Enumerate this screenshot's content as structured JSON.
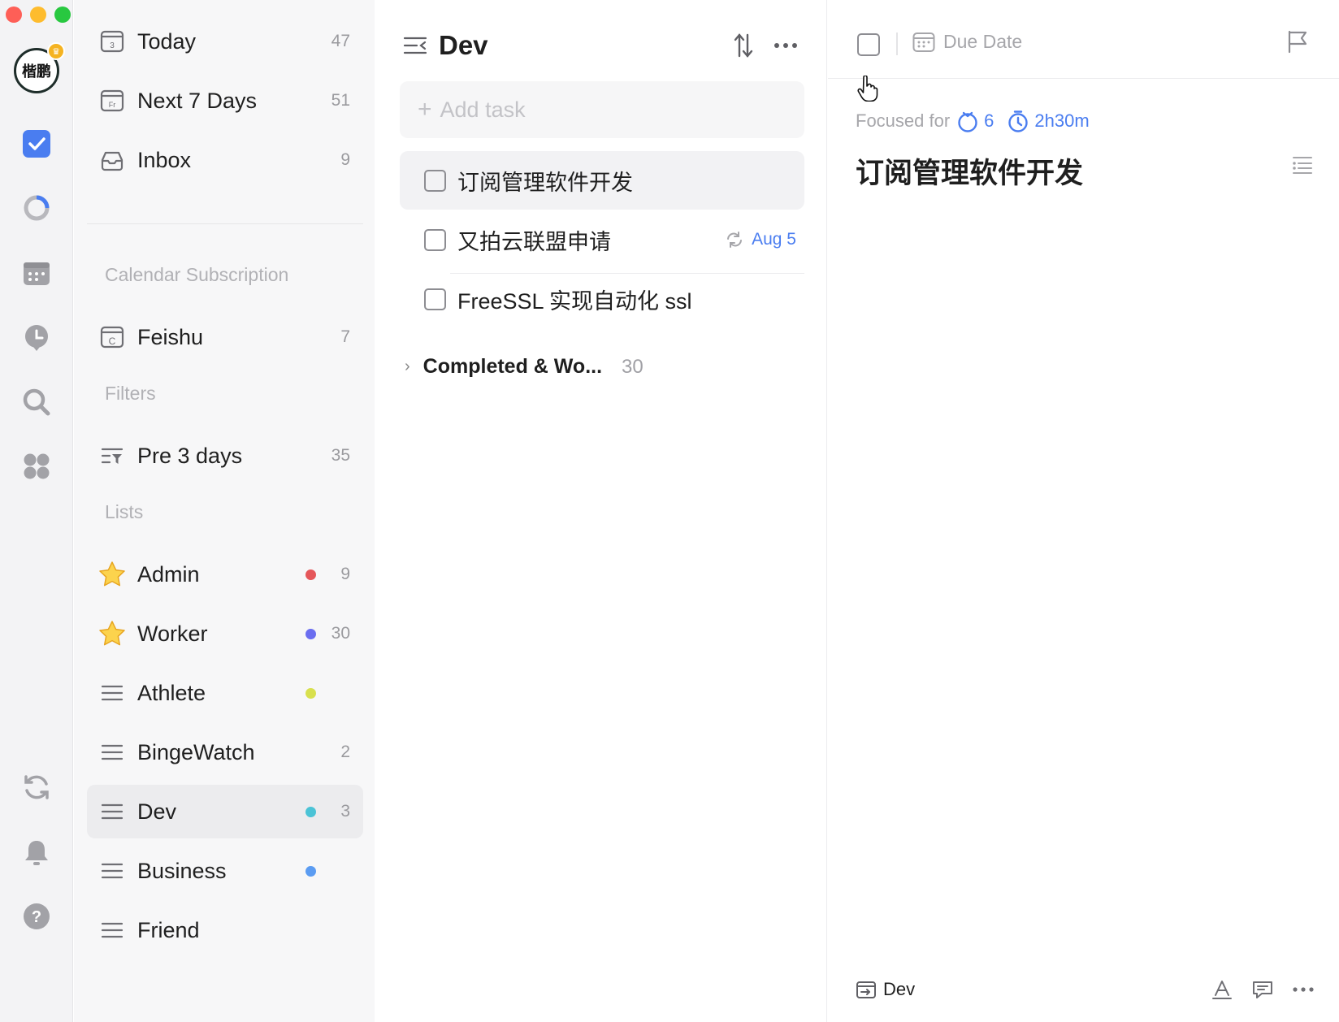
{
  "rail": {
    "avatar_text": "楷鹏",
    "icons": [
      "task-icon",
      "habit-icon",
      "calendar-icon",
      "pomodoro-icon",
      "search-icon",
      "apps-icon",
      "sync-icon",
      "bell-icon",
      "help-icon"
    ],
    "colors": {
      "accent": "#4a7df0",
      "traffic_red": "#fe5f57",
      "traffic_yellow": "#febc2e",
      "traffic_green": "#28c840",
      "crown": "#f5b321"
    }
  },
  "sidebar": {
    "smart": [
      {
        "label": "Today",
        "count": "47",
        "icon": "calendar-today-icon"
      },
      {
        "label": "Next 7 Days",
        "count": "51",
        "icon": "calendar-week-icon"
      },
      {
        "label": "Inbox",
        "count": "9",
        "icon": "inbox-icon"
      }
    ],
    "calendar_title": "Calendar Subscription",
    "calendar": [
      {
        "label": "Feishu",
        "count": "7",
        "icon": "calendar-subscription-icon"
      }
    ],
    "filters_title": "Filters",
    "filters": [
      {
        "label": "Pre 3 days",
        "count": "35",
        "icon": "filter-icon"
      }
    ],
    "lists_title": "Lists",
    "lists": [
      {
        "label": "Admin",
        "count": "9",
        "dot": "#e5575a",
        "icon": "star-icon"
      },
      {
        "label": "Worker",
        "count": "30",
        "dot": "#6b6ef0",
        "icon": "star-icon"
      },
      {
        "label": "Athlete",
        "count": "",
        "dot": "#d8e04e",
        "icon": "list-icon"
      },
      {
        "label": "BingeWatch",
        "count": "2",
        "dot": "",
        "icon": "list-icon"
      },
      {
        "label": "Dev",
        "count": "3",
        "dot": "#4bc3d6",
        "icon": "list-icon",
        "active": true
      },
      {
        "label": "Business",
        "count": "",
        "dot": "#5b9cf2",
        "icon": "list-icon"
      },
      {
        "label": "Friend",
        "count": "",
        "dot": "",
        "icon": "list-icon"
      }
    ]
  },
  "list": {
    "title": "Dev",
    "add_placeholder": "Add task",
    "tasks": [
      {
        "title": "订阅管理软件开发",
        "selected": true,
        "date": ""
      },
      {
        "title": "又拍云联盟申请",
        "selected": false,
        "date": "Aug 5"
      },
      {
        "title": "FreeSSL 实现自动化 ssl",
        "selected": false,
        "date": ""
      }
    ],
    "completed_label": "Completed & Wo...",
    "completed_count": "30"
  },
  "detail": {
    "due_label": "Due Date",
    "focused_label": "Focused for",
    "pomo_count": "6",
    "focus_duration": "2h30m",
    "title": "订阅管理软件开发",
    "project": "Dev"
  }
}
